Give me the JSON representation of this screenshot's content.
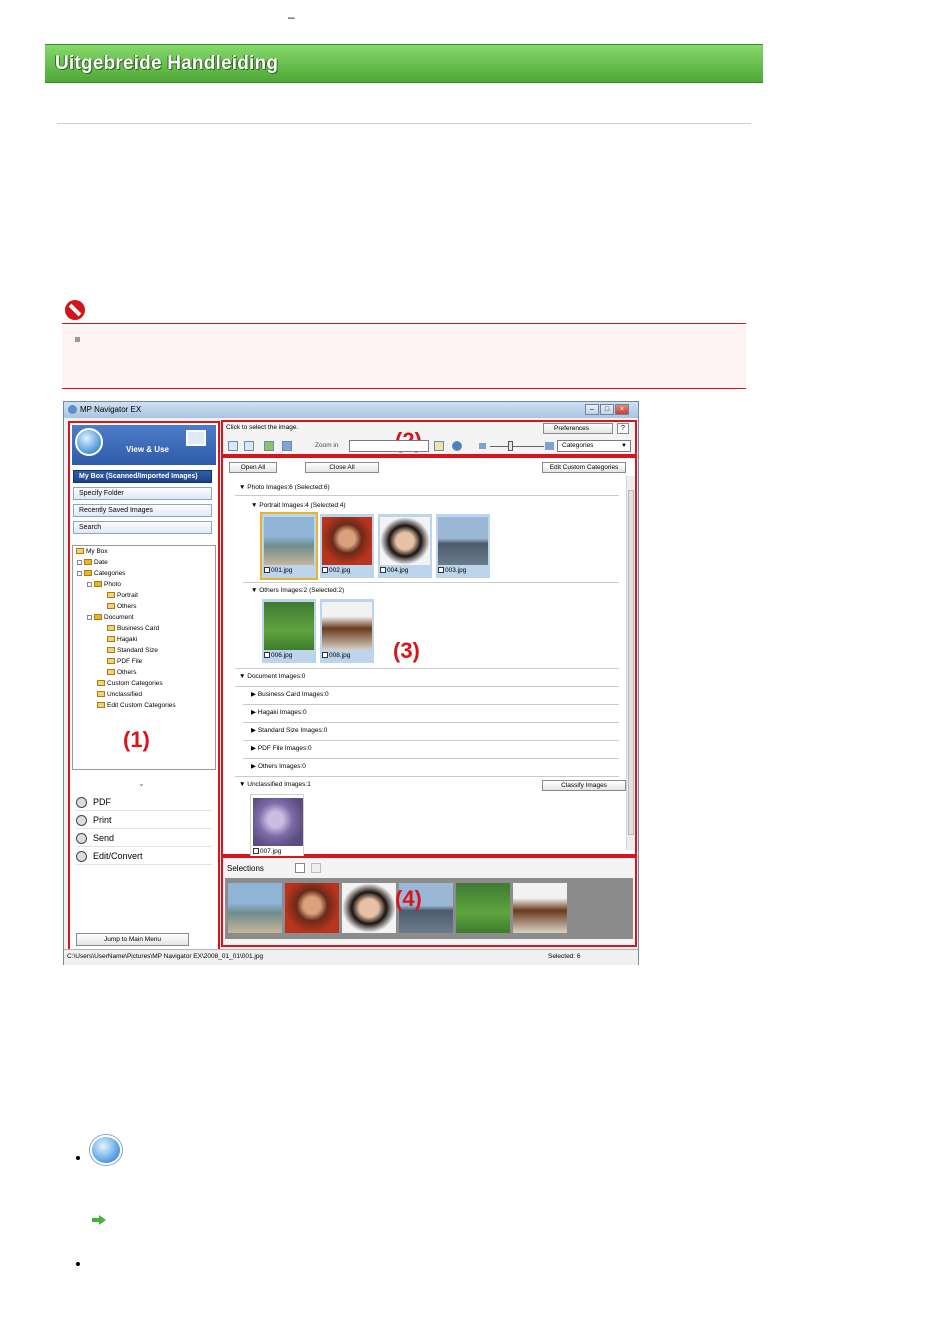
{
  "header": {
    "top_mark": "–",
    "title": "Uitgebreide Handleiding"
  },
  "app": {
    "title": "MP Navigator EX",
    "mode_label": "View & Use",
    "nav_buttons": [
      "My Box (Scanned/Imported Images)",
      "Specify Folder",
      "Recently Saved Images",
      "Search"
    ],
    "tree": [
      "My Box",
      "Date",
      "Categories",
      "Photo",
      "Portrait",
      "Others",
      "Document",
      "Business Card",
      "Hagaki",
      "Standard Size",
      "PDF File",
      "Others",
      "Custom Categories",
      "Unclassified",
      "Edit Custom Categories"
    ],
    "actions": [
      "PDF",
      "Print",
      "Send",
      "Edit/Convert"
    ],
    "jump_button": "Jump to Main Menu",
    "select_hint": "Click to select the image.",
    "preferences": "Preferences",
    "help": "?",
    "zoom_label": "Zoom in",
    "view_select": "Categories",
    "open_all": "Open All",
    "close_all": "Close All",
    "edit_custom_categories": "Edit Custom Categories",
    "classify_images": "Classify Images",
    "groups": {
      "photo": "Photo    Images:6    (Selected:6)",
      "portrait": "Portrait    Images:4    (Selected:4)",
      "others_photo": "Others    Images:2    (Selected:2)",
      "document": "Document    Images:0",
      "business_card": "Business Card    Images:0",
      "hagaki": "Hagaki    Images:0",
      "standard_size": "Standard Size    Images:0",
      "pdf_file": "PDF File    Images:0",
      "others_doc": "Others    Images:0",
      "unclassified": "Unclassified    Images:1"
    },
    "thumbnails": {
      "portrait": [
        "001.jpg",
        "002.jpg",
        "004.jpg",
        "003.jpg"
      ],
      "others": [
        "006.jpg",
        "008.jpg"
      ],
      "unclassified": [
        "007.jpg"
      ]
    },
    "selections_title": "Selections",
    "status_path": "C:\\Users\\UserName\\Pictures\\MP Navigator EX\\2008_01_01\\001.jpg",
    "status_selected": "Selected: 6"
  },
  "callouts": [
    "(1)",
    "(2)",
    "(3)",
    "(4)"
  ],
  "colors": {
    "header_green": "#4ea836",
    "callout_red": "#d8141c",
    "active_nav": "#1d4388"
  }
}
